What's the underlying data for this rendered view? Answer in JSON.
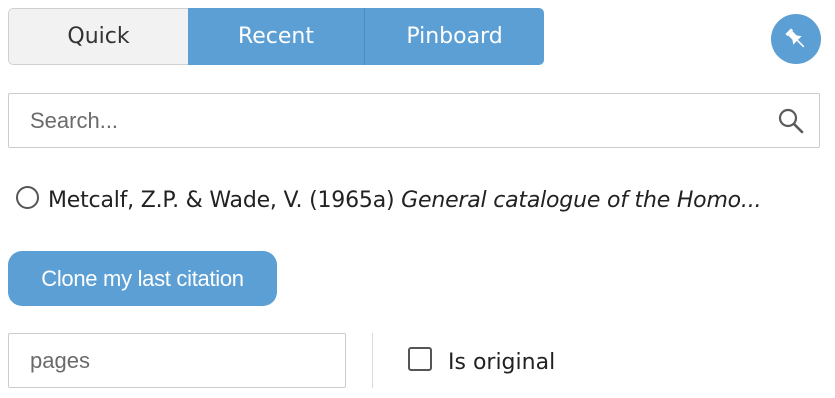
{
  "tabs": {
    "quick": "Quick",
    "recent": "Recent",
    "pinboard": "Pinboard"
  },
  "pin_button": {
    "icon": "pin-icon"
  },
  "search": {
    "placeholder": "Search...",
    "value": "",
    "icon": "search-icon"
  },
  "citation": {
    "selected": false,
    "authors": "Metcalf, Z.P. & Wade, V. (1965a)",
    "title": "General catalogue of the Homo..."
  },
  "clone_button": {
    "label": "Clone my last citation"
  },
  "pages": {
    "placeholder": "pages",
    "value": ""
  },
  "is_original": {
    "label": "Is original",
    "checked": false
  },
  "colors": {
    "accent": "#5b9fd4",
    "tab_inactive_bg": "#f2f2f2",
    "border": "#cccccc"
  }
}
